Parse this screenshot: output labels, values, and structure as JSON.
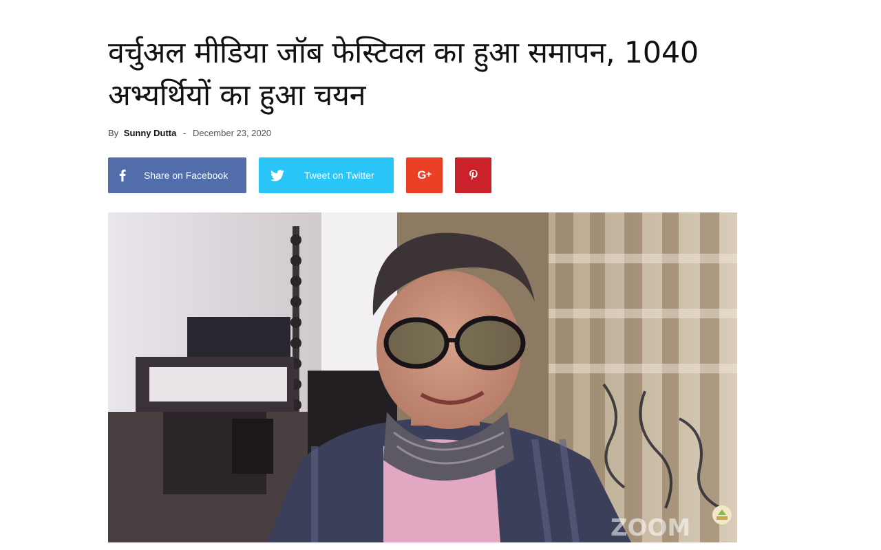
{
  "article": {
    "title": "वर्चुअल मीडिया जॉब फेस्टिवल का हुआ समापन, 1040 अभ्यर्थियों का हुआ चयन",
    "meta": {
      "by_label": "By",
      "author": "Sunny Dutta",
      "separator": "-",
      "date": "December 23, 2020"
    }
  },
  "share": {
    "facebook": {
      "label": "Share on Facebook",
      "icon": "facebook-icon",
      "color": "#516eab"
    },
    "twitter": {
      "label": "Tweet on Twitter",
      "icon": "twitter-icon",
      "color": "#29c5f6"
    },
    "googleplus": {
      "label": "G+",
      "icon": "google-plus-icon",
      "color": "#eb4026"
    },
    "pinterest": {
      "icon": "pinterest-icon",
      "color": "#ca212a"
    }
  },
  "photo": {
    "watermark": "ZOOM"
  }
}
